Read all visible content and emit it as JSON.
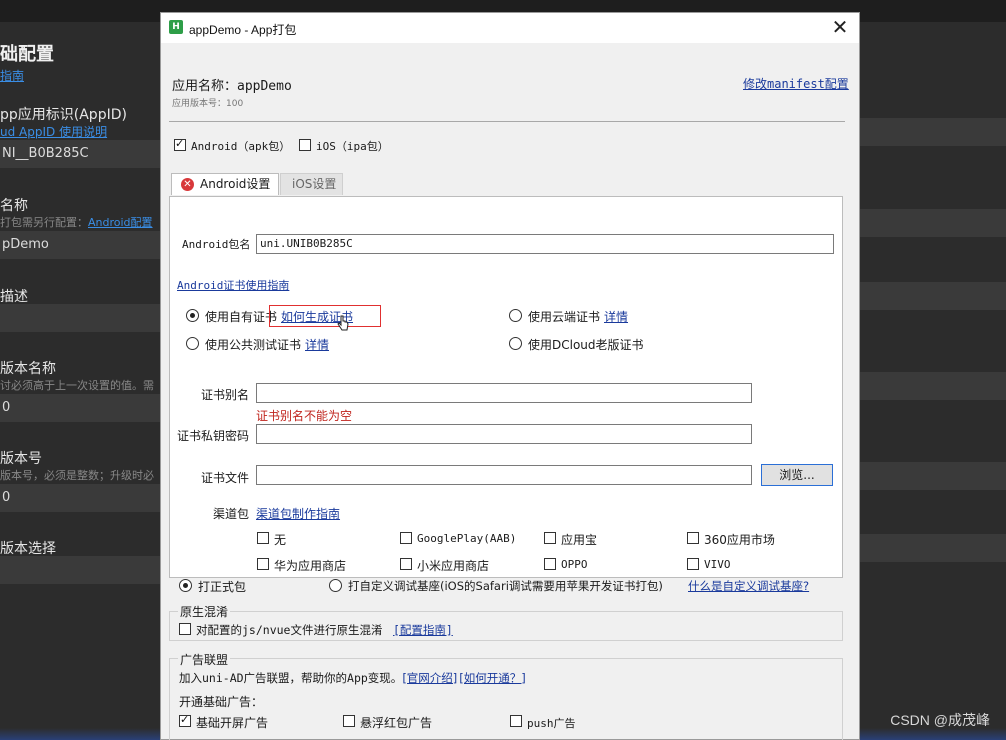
{
  "background": {
    "left_title": "础配置",
    "left_guide_link": "指南",
    "appid_label": "pp应用标识(AppID)",
    "appid_help_link": "ud AppID 使用说明",
    "appid_value": "NI__B0B285C",
    "name_label": "名称",
    "name_hint": "打包需另行配置：",
    "name_hint_link": "Android配置",
    "name_value": "pDemo",
    "desc_label": "描述",
    "version_name_label": "版本名称",
    "version_name_hint": "讨必须高于上一次设置的值。需",
    "version_name_value": "0",
    "version_code_label": "版本号",
    "version_code_hint": "版本号，必须是整数；升级时必",
    "version_code_value": "0",
    "version_select_label": "版本选择",
    "watermark": "CSDN @成茂峰"
  },
  "dialog": {
    "icon_letter": "H",
    "title": "appDemo - App打包",
    "close_glyph": "✕",
    "app_name_label": "应用名称：appDemo",
    "app_version_label": "应用版本号：100",
    "modify_manifest_link": "修改manifest配置",
    "platforms": {
      "android": {
        "label": "Android（apk包）",
        "checked": true
      },
      "ios": {
        "label": "iOS（ipa包）",
        "checked": false
      }
    },
    "tabs": [
      {
        "label": "Android设置",
        "active": true,
        "has_error": true
      },
      {
        "label": "iOS设置",
        "active": false,
        "has_error": false
      }
    ],
    "android": {
      "package_label": "Android包名",
      "package_value": "uni.UNIB0B285C",
      "cert_guide_link": "Android证书使用指南",
      "cert_options": [
        {
          "label": "使用自有证书",
          "link": "如何生成证书",
          "checked": true
        },
        {
          "label": "使用云端证书",
          "link": "详情",
          "checked": false
        },
        {
          "label": "使用公共测试证书",
          "link": "详情",
          "checked": false
        },
        {
          "label": "使用DCloud老版证书",
          "link": "",
          "checked": false
        }
      ],
      "alias_label": "证书别名",
      "alias_value": "",
      "alias_error": "证书别名不能为空",
      "key_password_label": "证书私钥密码",
      "key_password_value": "",
      "cert_file_label": "证书文件",
      "cert_file_value": "",
      "browse_button": "浏览...",
      "channel_label": "渠道包",
      "channel_guide_link": "渠道包制作指南",
      "channels": [
        {
          "label": "无",
          "checked": false
        },
        {
          "label": "GooglePlay(AAB)",
          "checked": false
        },
        {
          "label": "应用宝",
          "checked": false
        },
        {
          "label": "360应用市场",
          "checked": false
        },
        {
          "label": "华为应用商店",
          "checked": false
        },
        {
          "label": "小米应用商店",
          "checked": false
        },
        {
          "label": "OPPO",
          "checked": false
        },
        {
          "label": "VIVO",
          "checked": false
        }
      ]
    },
    "build_type": {
      "formal": {
        "label": "打正式包",
        "checked": true
      },
      "custom": {
        "label": "打自定义调试基座(iOS的Safari调试需要用苹果开发证书打包)",
        "checked": false
      },
      "custom_help_link": "什么是自定义调试基座?"
    },
    "obfuscation": {
      "title": "原生混淆",
      "option_label": "对配置的js/nvue文件进行原生混淆",
      "option_checked": false,
      "guide_link": "[配置指南]"
    },
    "ad": {
      "title": "广告联盟",
      "intro": "加入uni-AD广告联盟，帮助你的App变现。",
      "official_link": "[官网介绍]",
      "how_link": "[如何开通？]",
      "basic_label": "开通基础广告：",
      "options": [
        {
          "label": "基础开屏广告",
          "checked": true
        },
        {
          "label": "悬浮红包广告",
          "checked": false
        },
        {
          "label": "push广告",
          "checked": false
        }
      ]
    }
  }
}
